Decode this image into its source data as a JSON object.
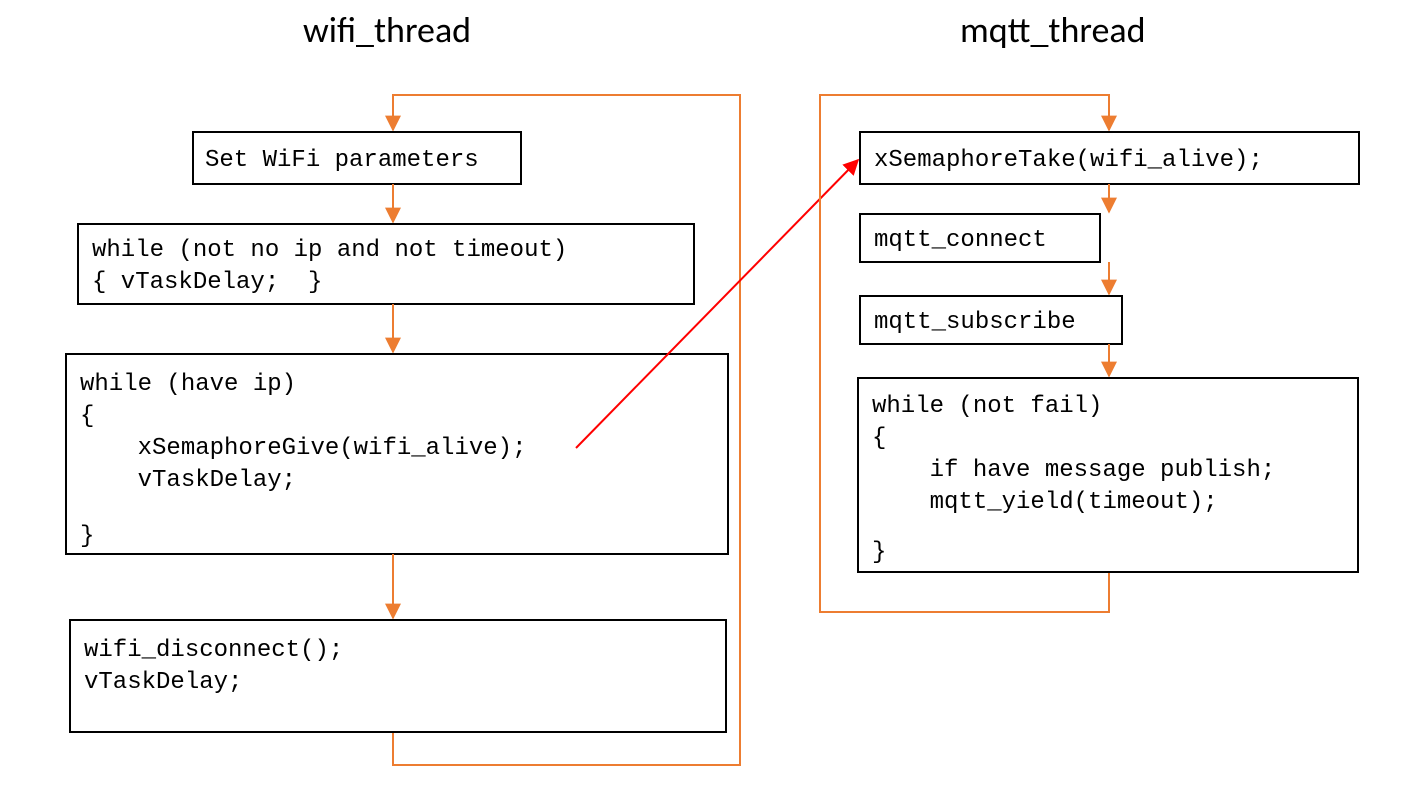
{
  "left": {
    "title": "wifi_thread",
    "box1": "Set WiFi parameters",
    "box2_l1": "while (not no ip and not timeout)",
    "box2_l2": "{ vTaskDelay;  }",
    "box3_l1": "while (have ip)",
    "box3_l2": "{",
    "box3_l3": "    xSemaphoreGive(wifi_alive);",
    "box3_l4": "    vTaskDelay;",
    "box3_l5": "}",
    "box4_l1": "wifi_disconnect();",
    "box4_l2": "vTaskDelay;"
  },
  "right": {
    "title": "mqtt_thread",
    "box1": "xSemaphoreTake(wifi_alive);",
    "box2": "mqtt_connect",
    "box3": "mqtt_subscribe",
    "box4_l1": "while (not fail)",
    "box4_l2": "{",
    "box4_l3": "    if have message publish;",
    "box4_l4": "    mqtt_yield(timeout);",
    "box4_l5": "}"
  }
}
